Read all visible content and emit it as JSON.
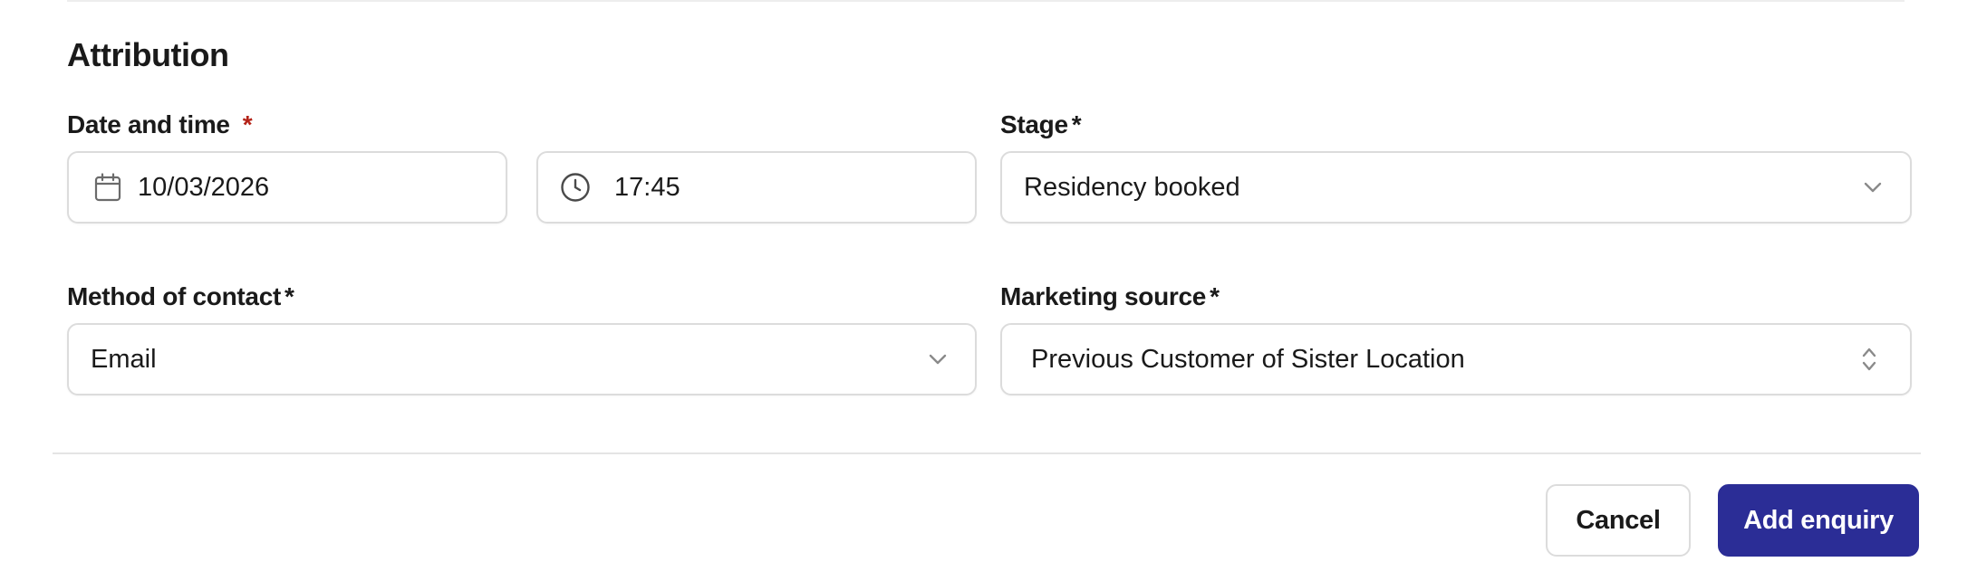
{
  "section": {
    "title": "Attribution"
  },
  "fields": {
    "datetime": {
      "label": "Date and time",
      "required_mark": "*",
      "date_value": "10/03/2026",
      "time_value": "17:45"
    },
    "stage": {
      "label": "Stage",
      "required_mark": "*",
      "value": "Residency booked"
    },
    "method_of_contact": {
      "label": "Method of contact",
      "required_mark": "*",
      "value": "Email"
    },
    "marketing_source": {
      "label": "Marketing source",
      "required_mark": "*",
      "value": "Previous Customer of Sister Location"
    }
  },
  "actions": {
    "cancel_label": "Cancel",
    "submit_label": "Add enquiry"
  },
  "colors": {
    "primary": "#2b2d96",
    "required_red": "#b42318",
    "border": "#dcdcdc"
  },
  "icons": {
    "date": "calendar-icon",
    "time": "clock-icon",
    "select": "chevron-down-icon",
    "combobox": "chevron-up-down-icon"
  }
}
